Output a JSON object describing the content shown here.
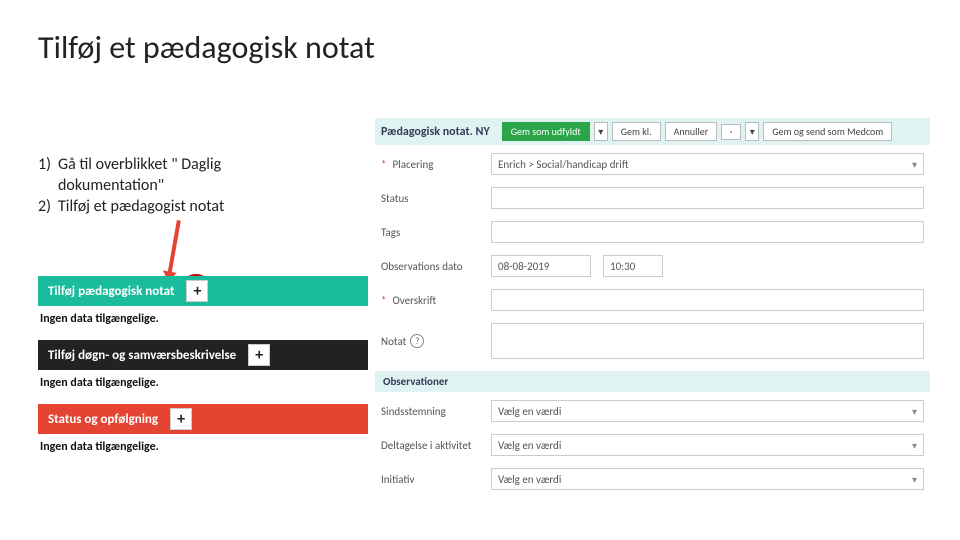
{
  "slide": {
    "title": "Tilføj et pædagogisk notat"
  },
  "steps": {
    "n1": "1)",
    "t1a": "Gå til overblikket \" Daglig",
    "t1b": "dokumentation\"",
    "n2": "2)",
    "t2": "Tilføj et pædagogist notat"
  },
  "left": {
    "teal": "Tilføj pædagogisk notat",
    "dark": "Tilføj døgn- og samværsbeskrivelse",
    "red": "Status og opfølgning",
    "nodata": "Ingen data tilgængelige.",
    "plus": "+"
  },
  "form": {
    "title": "Pædagogisk notat. NY",
    "btn_save_filled": "Gem som udfyldt",
    "btn_save_draft": "Gem kl.",
    "btn_cancel": "Annuller",
    "btn_medcom": "Gem og send som Medcom",
    "labels": {
      "placering": "Placering",
      "status": "Status",
      "tags": "Tags",
      "obsdato": "Observations dato",
      "overskrift": "Overskrift",
      "notat": "Notat"
    },
    "values": {
      "placering": "Enrich > Social/handicap drift",
      "date": "08-08-2019",
      "time": "10:30"
    },
    "obs_header": "Observationer",
    "obs": {
      "l1": "Sindsstemning",
      "l2": "Deltagelse i aktivitet",
      "l3": "Initiativ",
      "ph": "Vælg en værdi"
    }
  }
}
